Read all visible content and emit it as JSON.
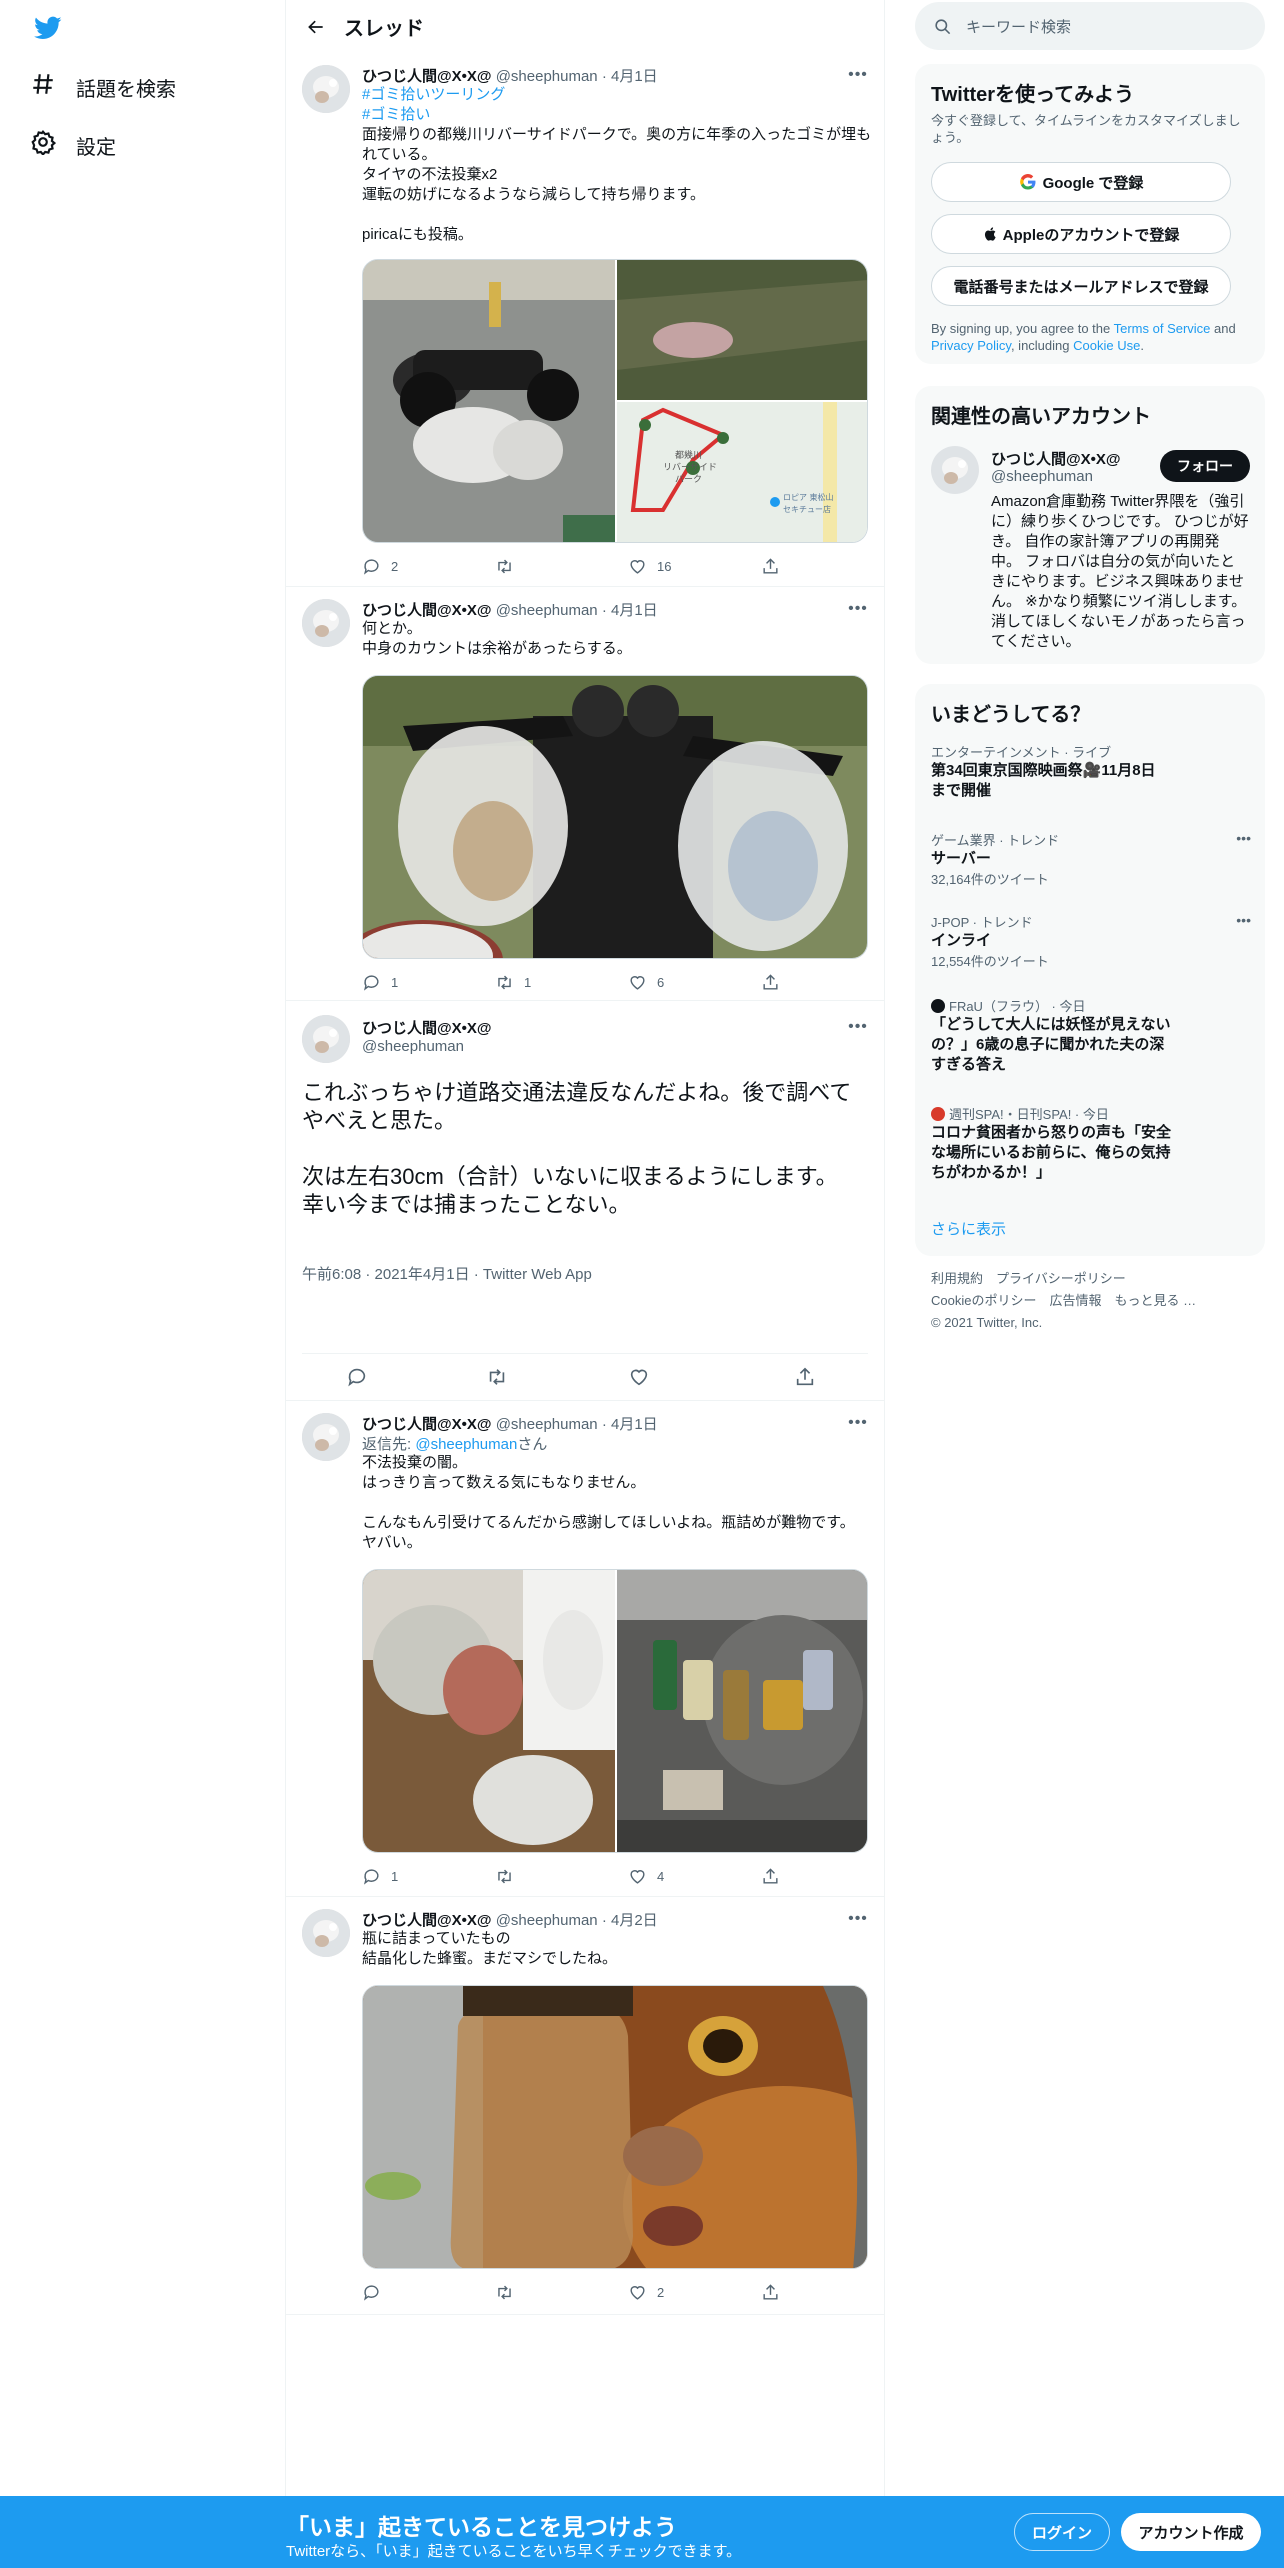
{
  "leftnav": {
    "items": [
      {
        "label": "話題を検索",
        "icon": "hashtag-icon"
      },
      {
        "label": "設定",
        "icon": "gear-icon"
      }
    ]
  },
  "header": {
    "title": "スレッド"
  },
  "tweets": [
    {
      "name": "ひつじ人間@X•X@",
      "handle": "@sheephuman",
      "date": "4月1日",
      "hashtags": [
        "#ゴミ拾いツーリング",
        "#ゴミ拾い"
      ],
      "text": "面接帰りの都幾川リバーサイドパークで。奥の方に年季の入ったゴミが埋もれている。\nタイヤの不法投棄x2\n運転の妨げになるようなら減らして持ち帰ります。\n\npiricaにも投稿。",
      "map_labels": [
        "都幾川",
        "リバーサイド",
        "パーク",
        "ロピア 東松山",
        "セキチュー店"
      ],
      "replies": "2",
      "retweets": "",
      "likes": "16"
    },
    {
      "name": "ひつじ人間@X•X@",
      "handle": "@sheephuman",
      "date": "4月1日",
      "text": "何とか。\n中身のカウントは余裕があったらする。",
      "replies": "1",
      "retweets": "1",
      "likes": "6"
    },
    {
      "name": "ひつじ人間@X•X@",
      "handle": "@sheephuman",
      "text": "これぶっちゃけ道路交通法違反なんだよね。後で調べてやべえと思た。\n\n次は左右30cm（合計）いないに収まるようにします。\n幸い今までは捕まったことない。",
      "meta": "午前6:08 · 2021年4月1日 · Twitter Web App"
    },
    {
      "name": "ひつじ人間@X•X@",
      "handle": "@sheephuman",
      "date": "4月1日",
      "reply_prefix": "返信先: ",
      "reply_to": "@sheephuman",
      "reply_suffix": "さん",
      "text": "不法投棄の闇。\nはっきり言って数える気にもなりません。\n\nこんなもん引受けてるんだから感謝してほしいよね。瓶詰めが難物です。\nヤバい。",
      "replies": "1",
      "retweets": "",
      "likes": "4"
    },
    {
      "name": "ひつじ人間@X•X@",
      "handle": "@sheephuman",
      "date": "4月2日",
      "text": "瓶に詰まっていたもの\n結晶化した蜂蜜。まだマシでしたね。",
      "replies": "",
      "retweets": "",
      "likes": "2"
    }
  ],
  "search": {
    "placeholder": "キーワード検索"
  },
  "signup": {
    "title": "Twitterを使ってみよう",
    "subtitle": "今すぐ登録して、タイムラインをカスタマイズしましょう。",
    "google": "Google で登録",
    "apple": "Appleのアカウントで登録",
    "phone": "電話番号またはメールアドレスで登録",
    "terms_pre": "By signing up, you agree to the ",
    "terms_link": "Terms of Service",
    "terms_and": " and ",
    "privacy_link": "Privacy Policy",
    "terms_incl": ", including ",
    "cookie_link": "Cookie Use",
    "terms_end": "."
  },
  "related": {
    "title": "関連性の高いアカウント",
    "name": "ひつじ人間@X•X@",
    "handle": "@sheephuman",
    "follow": "フォロー",
    "bio": "Amazon倉庫勤務 Twitter界隈を（強引に）練り歩くひつじです。 ひつじが好き。 自作の家計簿アプリの再開発中。 フォロバは自分の気が向いたときにやります。ビジネス興味ありません。 ※かなり頻繁にツイ消しします。消してほしくないモノがあったら言ってください。"
  },
  "trends": {
    "title": "いまどうしてる？",
    "items": [
      {
        "category": "エンターテインメント · ライブ",
        "title": "第34回東京国際映画祭🎥11月8日まで開催",
        "count": ""
      },
      {
        "category": "ゲーム業界 · トレンド",
        "title": "サーバー",
        "count": "32,164件のツイート"
      },
      {
        "category": "J-POP · トレンド",
        "title": "インライ",
        "count": "12,554件のツイート"
      },
      {
        "category": "FRaU（フラウ） · 今日",
        "title": "「どうして大人には妖怪が見えないの？」6歳の息子に聞かれた夫の深すぎる答え",
        "count": ""
      },
      {
        "category": "週刊SPA!・日刊SPA! · 今日",
        "title": "コロナ貧困者から怒りの声も「安全な場所にいるお前らに、俺らの気持ちがわかるか！」",
        "count": ""
      }
    ],
    "more": "さらに表示"
  },
  "footer": {
    "line1": "利用規約　プライバシーポリシー",
    "line2": "Cookieのポリシー　広告情報　もっと見る …",
    "line3": "© 2021 Twitter, Inc."
  },
  "bottombar": {
    "title": "「いま」起きていることを見つけよう",
    "subtitle": "Twitterなら、「いま」起きていることをいち早くチェックできます。",
    "login": "ログイン",
    "signup": "アカウント作成"
  },
  "colors": {
    "accent": "#1d9bf0",
    "text": "#0f1419",
    "muted": "#536471"
  }
}
